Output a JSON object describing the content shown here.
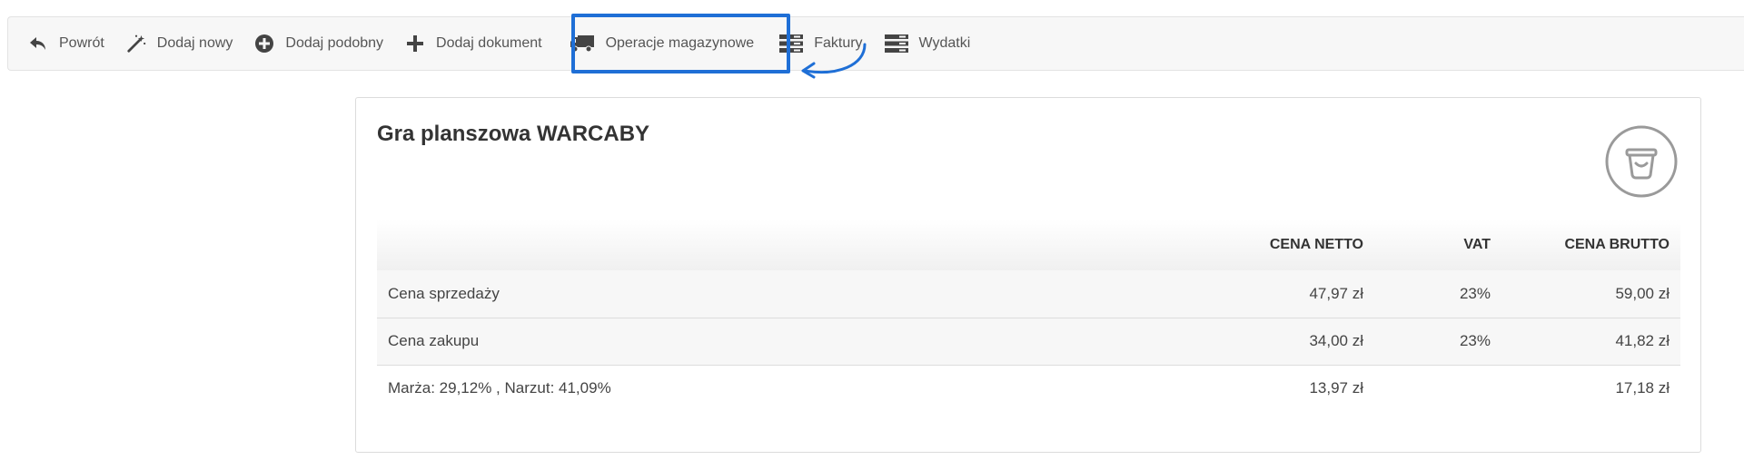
{
  "toolbar": {
    "items": [
      {
        "label": "Powrót",
        "icon": "reply-arrow-icon"
      },
      {
        "label": "Dodaj nowy",
        "icon": "magic-wand-icon"
      },
      {
        "label": "Dodaj podobny",
        "icon": "plus-circle-icon"
      },
      {
        "label": "Dodaj dokument",
        "icon": "plus-icon"
      },
      {
        "label": "Operacje magazynowe",
        "icon": "truck-icon"
      },
      {
        "label": "Faktury",
        "icon": "server-list-icon"
      },
      {
        "label": "Wydatki",
        "icon": "server-list-icon"
      }
    ],
    "highlight_color": "#1f6fd6"
  },
  "product": {
    "title": "Gra planszowa WARCABY",
    "icon": "shopping-basket-icon"
  },
  "table": {
    "headers": [
      "",
      "CENA NETTO",
      "VAT",
      "CENA BRUTTO"
    ],
    "rows": [
      [
        "Cena sprzedaży",
        "47,97 zł",
        "23%",
        "59,00 zł"
      ],
      [
        "Cena zakupu",
        "34,00 zł",
        "23%",
        "41,82 zł"
      ],
      [
        "Marża: 29,12% , Narzut: 41,09%",
        "13,97 zł",
        "",
        "17,18 zł"
      ]
    ]
  }
}
